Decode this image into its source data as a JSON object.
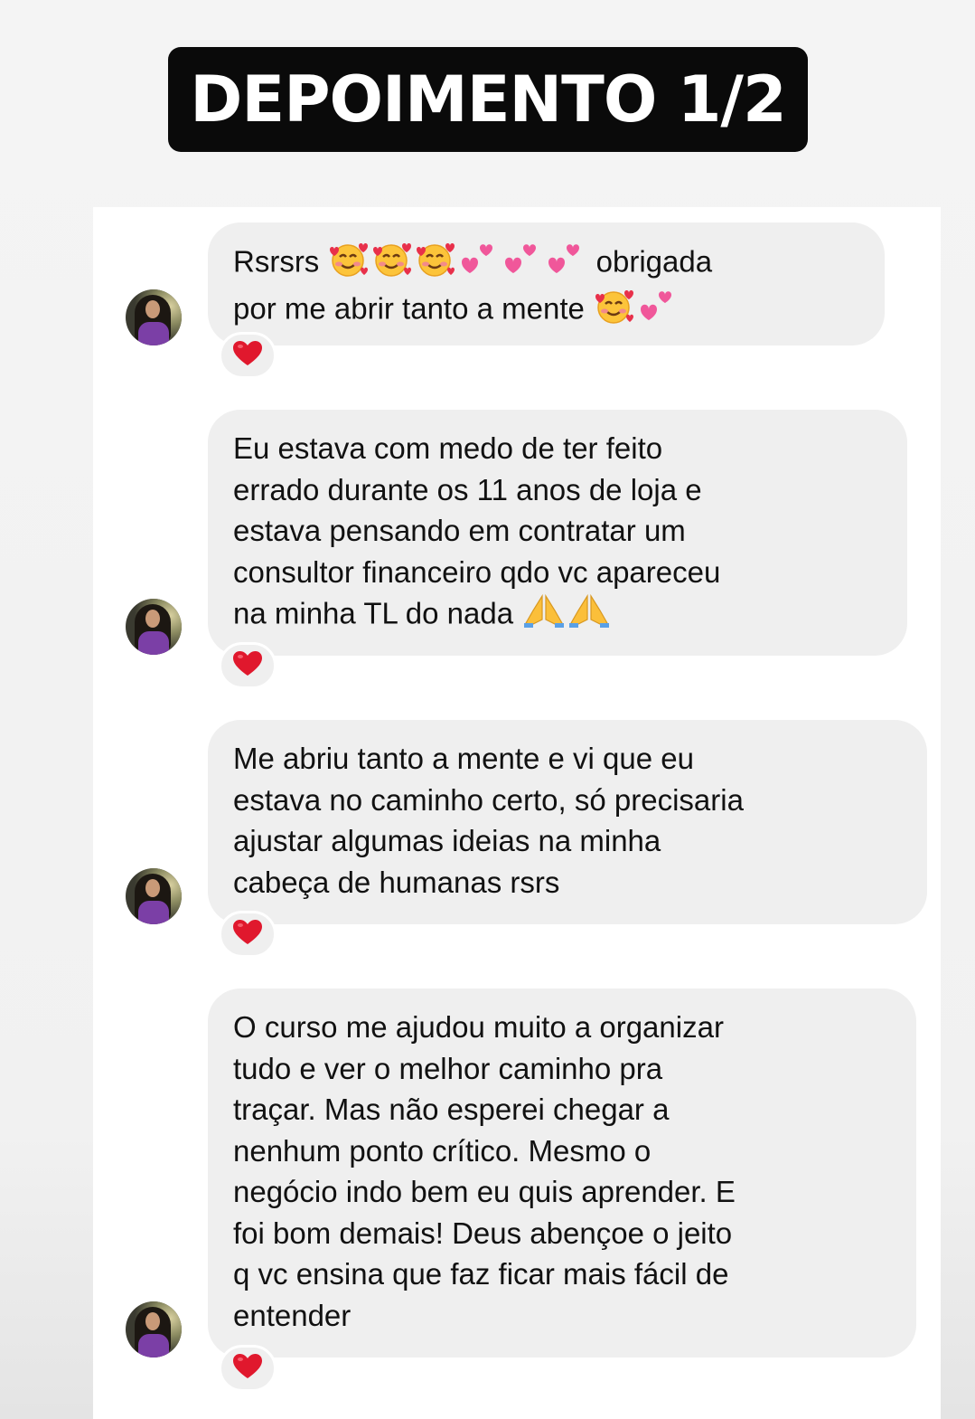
{
  "header": {
    "title": "DEPOIMENTO 1/2"
  },
  "messages": [
    {
      "lines": [
        "Rsrsrs",
        "obrigada",
        "por me abrir tanto a mente"
      ],
      "reaction": "red-heart",
      "emojis_line1": [
        "smiling-face-with-hearts",
        "smiling-face-with-hearts",
        "smiling-face-with-hearts",
        "two-hearts",
        "two-hearts",
        "two-hearts"
      ],
      "emojis_line2": [
        "smiling-face-with-hearts",
        "two-hearts"
      ]
    },
    {
      "lines": [
        "Eu estava com medo de ter feito",
        "errado durante os 11 anos de loja e",
        "estava pensando em contratar um",
        "consultor financeiro qdo vc apareceu",
        "na minha TL do nada"
      ],
      "reaction": "red-heart",
      "emojis_last_line": [
        "folded-hands",
        "folded-hands"
      ]
    },
    {
      "lines": [
        "Me abriu tanto a mente e vi que eu",
        "estava no caminho certo, só precisaria",
        "ajustar algumas ideias na minha",
        "cabeça de humanas rsrs"
      ],
      "reaction": "red-heart"
    },
    {
      "lines": [
        "O curso me ajudou muito a organizar",
        "tudo e ver o melhor caminho pra",
        "traçar. Mas não esperei chegar a",
        "nenhum ponto crítico. Mesmo o",
        "negócio indo bem eu quis aprender. E",
        "foi bom demais! Deus abençoe o jeito",
        "q vc ensina que faz ficar mais fácil de",
        "entender"
      ],
      "reaction": "red-heart"
    }
  ],
  "colors": {
    "badge_bg": "#0a0a0a",
    "badge_text": "#ffffff",
    "bubble_bg": "#efefef",
    "text": "#111111",
    "heart": "#e0182d"
  }
}
